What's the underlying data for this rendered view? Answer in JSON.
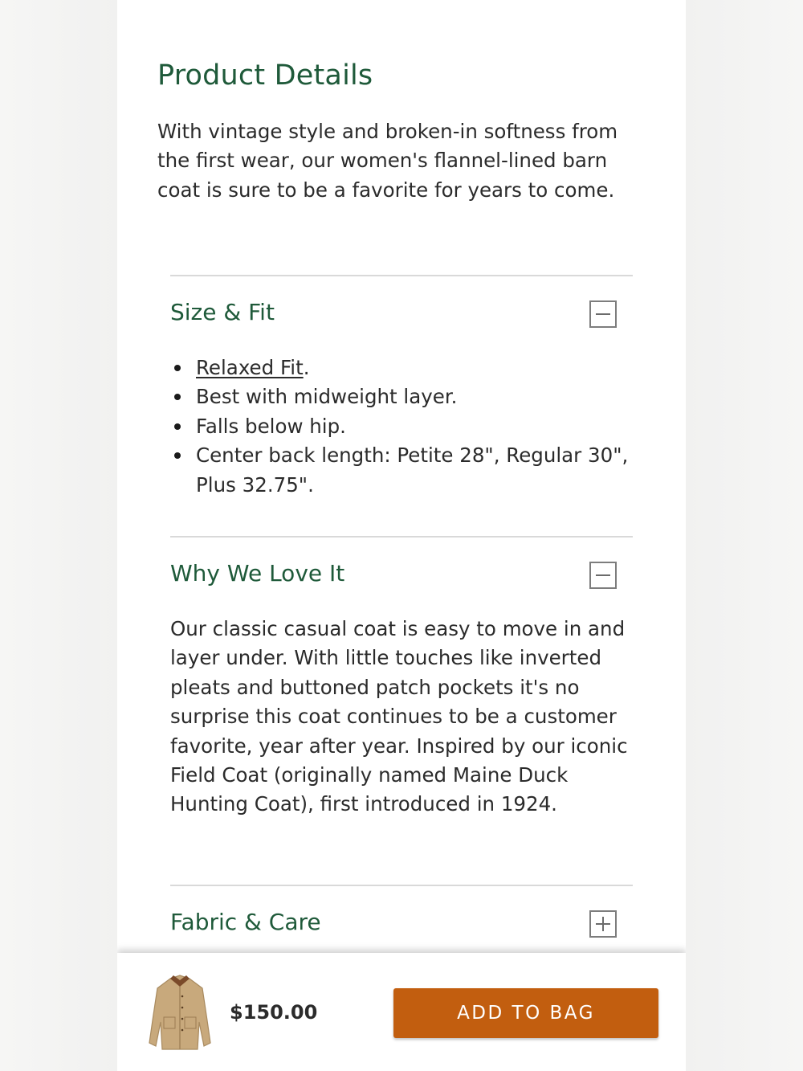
{
  "product_details": {
    "title": "Product Details",
    "description": "With vintage style and broken-in softness from the first wear, our women's flannel-lined barn coat is sure to be a favorite for years to come."
  },
  "sections": {
    "size_fit": {
      "title": "Size & Fit",
      "toggle_icon": "minus-icon",
      "bullet_1_link": "Relaxed Fit",
      "bullet_1_suffix": ".",
      "bullet_2": "Best with midweight layer.",
      "bullet_3": "Falls below hip.",
      "bullet_4": "Center back length: Petite 28\", Regular 30\", Plus 32.75\"."
    },
    "why_we_love_it": {
      "title": "Why We Love It",
      "toggle_icon": "minus-icon",
      "body": "Our classic casual coat is easy to move in and layer under. With little touches like inverted pleats and buttoned patch pockets it's no surprise this coat continues to be a customer favorite, year after year. Inspired by our iconic Field Coat (originally named Maine Duck Hunting Coat), first introduced in 1924."
    },
    "fabric_care": {
      "title": "Fabric & Care",
      "toggle_icon": "plus-icon"
    }
  },
  "bottom_bar": {
    "price": "$150.00",
    "add_to_bag_label": "ADD TO BAG",
    "thumbnail_icon": "barn-coat-thumbnail"
  },
  "colors": {
    "heading_green": "#1f5a3a",
    "button_orange": "#c25e0f",
    "text": "#2b2b2b",
    "divider": "#d9d9d9"
  }
}
